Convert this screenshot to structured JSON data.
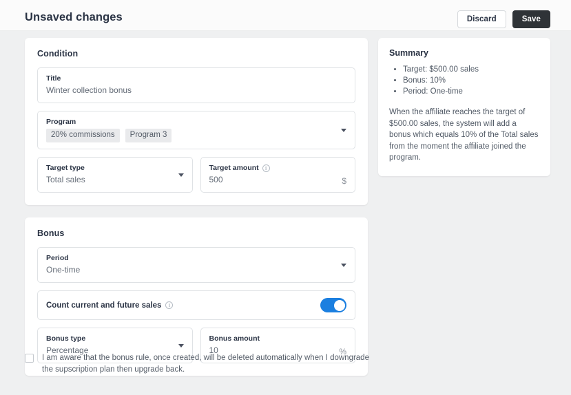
{
  "header": {
    "title": "Unsaved changes",
    "discard_label": "Discard",
    "save_label": "Save"
  },
  "condition": {
    "card_title": "Condition",
    "title_field": {
      "label": "Title",
      "value": "Winter collection bonus"
    },
    "program_field": {
      "label": "Program",
      "tags": [
        "20% commissions",
        "Program 3"
      ]
    },
    "target_type_field": {
      "label": "Target type",
      "value": "Total sales"
    },
    "target_amount_field": {
      "label": "Target amount",
      "value": "500",
      "suffix": "$"
    }
  },
  "bonus": {
    "card_title": "Bonus",
    "period_field": {
      "label": "Period",
      "value": "One-time"
    },
    "count_sales_toggle": {
      "label": "Count current and future sales",
      "state": "on"
    },
    "bonus_type_field": {
      "label": "Bonus type",
      "value": "Percentage"
    },
    "bonus_amount_field": {
      "label": "Bonus amount",
      "value": "10",
      "suffix": "%"
    }
  },
  "summary": {
    "title": "Summary",
    "items": [
      "Target: $500.00 sales",
      "Bonus: 10%",
      "Period: One-time"
    ],
    "description": "When the affiliate reaches the target of $500.00 sales, the system will add a bonus which equals 10% of the Total sales from the moment the affiliate joined the program."
  },
  "consent": {
    "text": "I am aware that the bonus rule, once created, will be deleted automatically when I downgrade the supscription plan then upgrade back.",
    "checked": false
  },
  "colors": {
    "accent": "#1b7fe0",
    "save_button": "#2f3337",
    "page_background": "#eff0f1",
    "text_dark": "#2b3445",
    "text_muted": "#646c77"
  }
}
